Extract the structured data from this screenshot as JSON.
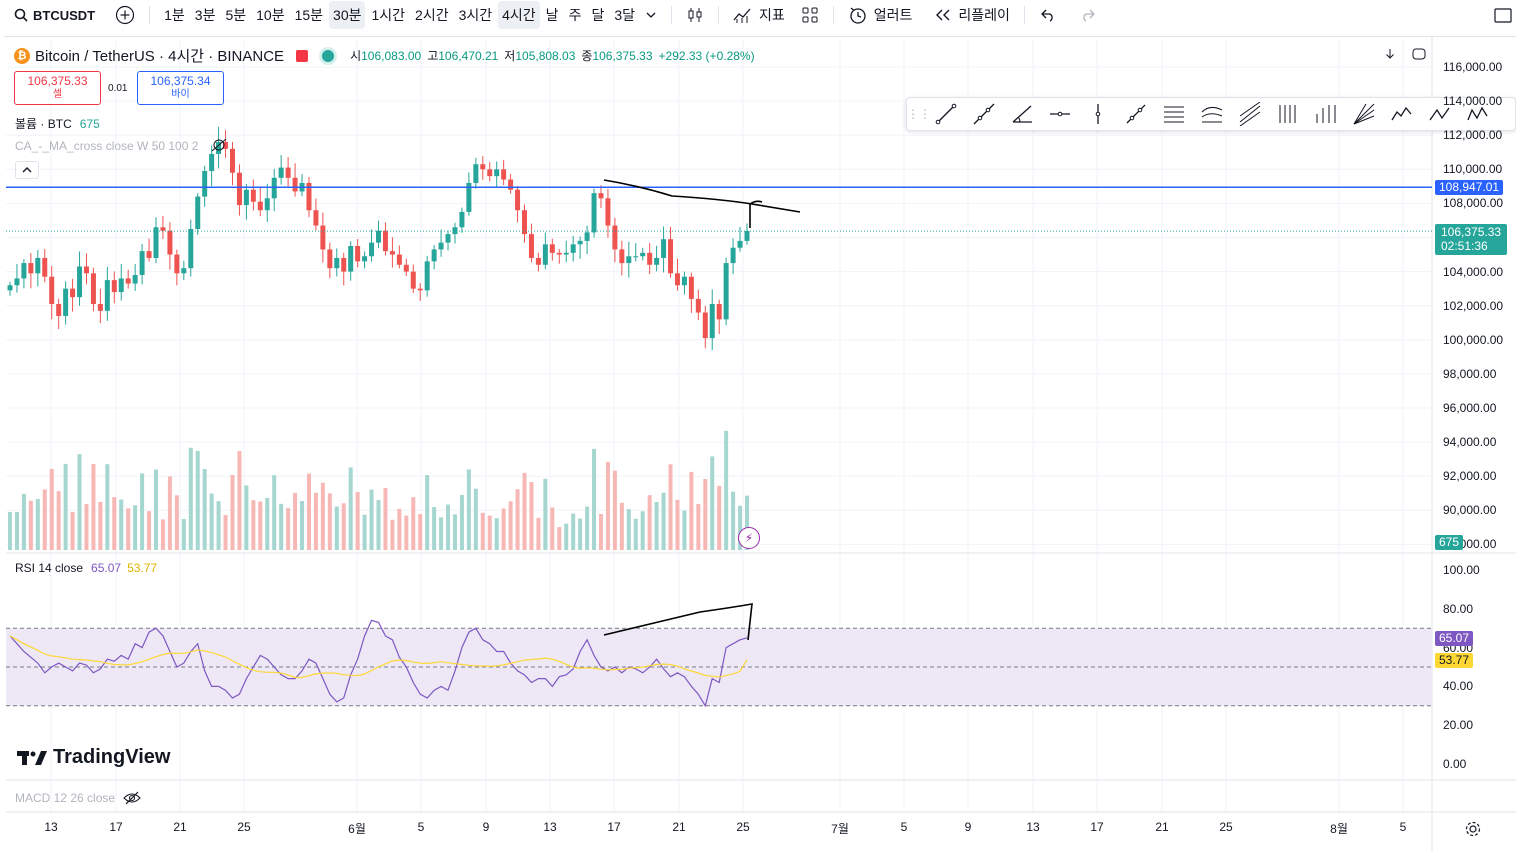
{
  "toolbar": {
    "symbol": "BTCUSDT",
    "intervals": [
      "1분",
      "3분",
      "5분",
      "10분",
      "15분",
      "30분",
      "1시간",
      "2시간",
      "3시간",
      "4시간",
      "날",
      "주",
      "달",
      "3달"
    ],
    "indicators_label": "지표",
    "alert_label": "얼러트",
    "replay_label": "리플레이"
  },
  "legend": {
    "title": "Bitcoin / TetherUS · 4시간 · BINANCE",
    "open_label": "시",
    "open": "106,083.00",
    "high_label": "고",
    "high": "106,470.21",
    "low_label": "저",
    "low": "105,808.03",
    "close_label": "종",
    "close": "106,375.33",
    "change": "+292.33 (+0.28%)"
  },
  "trade": {
    "sell_price": "106,375.33",
    "sell_label": "셀",
    "spread": "0.01",
    "buy_price": "106,375.34",
    "buy_label": "바이"
  },
  "volume_legend": {
    "label": "볼륨 · BTC",
    "value": "675"
  },
  "ma_legend": "CA_-_MA_cross close W 50 100 2",
  "rsi_legend": {
    "label": "RSI 14 close",
    "rsi": "65.07",
    "ma": "53.77"
  },
  "macd_legend": "MACD 12 26 close",
  "watermark": "TradingView",
  "price_axis": {
    "ticks": [
      "116,000.00",
      "114,000.00",
      "112,000.00",
      "110,000.00",
      "108,000.00",
      "106,000.00",
      "104,000.00",
      "102,000.00",
      "100,000.00",
      "98,000.00",
      "96,000.00",
      "94,000.00",
      "92,000.00",
      "90,000.00",
      "88,000.00"
    ],
    "hline_tag": "108,947.01",
    "current_tag": "106,375.33",
    "countdown": "02:51:36",
    "volume_tag": "675"
  },
  "rsi_axis": {
    "ticks": [
      "100.00",
      "80.00",
      "60.00",
      "40.00",
      "20.00",
      "0.00"
    ],
    "rsi_tag": "65.07",
    "ma_tag": "53.77"
  },
  "time_axis": [
    "13",
    "17",
    "21",
    "25",
    "6월",
    "5",
    "9",
    "13",
    "17",
    "21",
    "25",
    "7월",
    "5",
    "9",
    "13",
    "17",
    "21",
    "25",
    "8월",
    "5"
  ],
  "colors": {
    "up": "#26a69a",
    "down": "#ef5350",
    "hline": "#2962ff",
    "rsi": "#7e57c2",
    "rsi_ma": "#fdd835",
    "rsi_band": "#ede7f6"
  },
  "chart_data": {
    "type": "candlestick",
    "y_range_price": [
      88000,
      116000
    ],
    "horizontal_line": 108947.01,
    "last_price": 106375.33,
    "closes": [
      103200,
      103600,
      104500,
      103900,
      104800,
      103700,
      102100,
      101400,
      103000,
      102500,
      104300,
      103900,
      102100,
      101700,
      103500,
      102800,
      103600,
      103300,
      103800,
      105200,
      104800,
      106600,
      106400,
      105000,
      103900,
      104200,
      106500,
      108400,
      109900,
      110900,
      111600,
      111200,
      109800,
      107900,
      108800,
      108100,
      107600,
      108300,
      109500,
      110100,
      109500,
      108700,
      109200,
      107600,
      106700,
      105300,
      104200,
      104800,
      104000,
      105500,
      104600,
      104900,
      105700,
      106400,
      105200,
      105000,
      104400,
      104000,
      103000,
      102900,
      104600,
      105300,
      105700,
      106200,
      106600,
      107500,
      109200,
      110300,
      110000,
      109600,
      110000,
      109400,
      108800,
      107600,
      106200,
      104800,
      104400,
      105600,
      105100,
      105000,
      105100,
      105600,
      105800,
      106300,
      108600,
      108300,
      106700,
      105300,
      104500,
      104900,
      104900,
      105100,
      104400,
      104800,
      105900,
      103900,
      103200,
      103700,
      102400,
      101600,
      100100,
      102100,
      101200,
      104500,
      105400,
      105800,
      106380
    ],
    "rsi": [
      66,
      62,
      58,
      55,
      52,
      47,
      50,
      52,
      50,
      48,
      52,
      51,
      47,
      49,
      54,
      53,
      56,
      54,
      62,
      60,
      68,
      70,
      66,
      58,
      50,
      52,
      58,
      62,
      48,
      40,
      40,
      38,
      34,
      36,
      44,
      50,
      56,
      54,
      50,
      46,
      44,
      44,
      48,
      54,
      52,
      44,
      36,
      32,
      34,
      46,
      54,
      66,
      74,
      73,
      66,
      64,
      55,
      50,
      42,
      36,
      34,
      38,
      40,
      38,
      48,
      60,
      68,
      70,
      64,
      62,
      58,
      58,
      52,
      48,
      46,
      42,
      44,
      44,
      40,
      45,
      46,
      49,
      58,
      64,
      56,
      50,
      48,
      50,
      47,
      50,
      49,
      47,
      50,
      54,
      49,
      45,
      47,
      45,
      40,
      36,
      30,
      44,
      42,
      60,
      62,
      64,
      65.07
    ],
    "rsi_ma_last": 53.77
  }
}
